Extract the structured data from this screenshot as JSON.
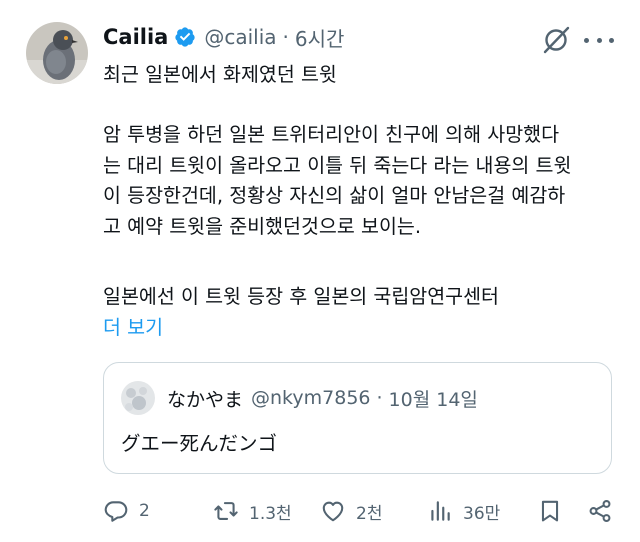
{
  "tweet": {
    "display_name": "Cailia",
    "handle": "@cailia",
    "separator": "·",
    "time": "6시간",
    "avatar_icon": "pigeon-avatar",
    "lines": [
      "최근 일본에서 화제였던 트윗",
      "암 투병을 하던 일본 트위터리안이 친구에 의해 사망했다",
      "는 대리 트윗이 올라오고 이틀 뒤 죽는다 라는 내용의 트윗",
      "이 등장한건데, 정황상 자신의 삶이 얼마 안남은걸 예감하",
      "고 예약 트윗을 준비했던것으로 보이는.",
      "일본에선 이 트윗 등장 후 일본의 국립암연구센터"
    ],
    "show_more": "더 보기"
  },
  "quote": {
    "display_name": "なかやま",
    "handle": "@nkym7856",
    "separator": "·",
    "time": "10월 14일",
    "text": "グエー死んだンゴ"
  },
  "actions": {
    "replies": "2",
    "reposts": "1.3천",
    "likes": "2천",
    "views": "36만"
  },
  "colors": {
    "accent": "#1d9bf0",
    "muted": "#536471",
    "text": "#0f1419",
    "border": "#cfd9de"
  }
}
